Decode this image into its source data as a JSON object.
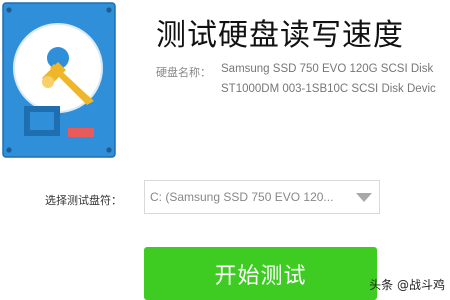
{
  "window": {
    "title": "测试硬盘读写速度"
  },
  "disk_info": {
    "label": "硬盘名称：",
    "disks": [
      "Samsung SSD 750 EVO 120G SCSI Disk",
      "ST1000DM 003-1SB10C SCSI Disk Devic"
    ]
  },
  "drive_select": {
    "label": "选择测试盘符：",
    "selected": "C:  (Samsung SSD 750 EVO 120..."
  },
  "start_button": {
    "label": "开始测试"
  },
  "watermark": "头条 @战斗鸡",
  "colors": {
    "accent_green": "#3fcc22",
    "icon_blue": "#2f8fd8",
    "icon_pointer": "#f0b62a"
  },
  "icons": {
    "app_icon": "hard-disk-icon",
    "dropdown": "chevron-down-icon"
  }
}
